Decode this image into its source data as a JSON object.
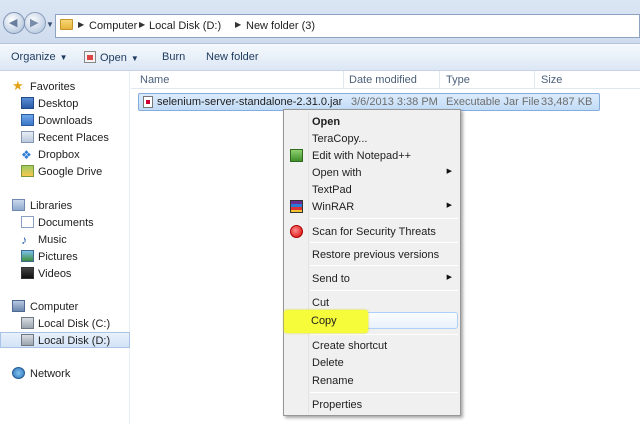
{
  "address": {
    "crumbs": [
      "Computer",
      "Local Disk (D:)",
      "New folder (3)"
    ]
  },
  "toolbar": {
    "organize": "Organize",
    "open": "Open",
    "burn": "Burn",
    "new_folder": "New folder"
  },
  "nav": {
    "favorites": "Favorites",
    "desktop": "Desktop",
    "downloads": "Downloads",
    "recent_places": "Recent Places",
    "dropbox": "Dropbox",
    "google_drive": "Google Drive",
    "libraries": "Libraries",
    "documents": "Documents",
    "music": "Music",
    "pictures": "Pictures",
    "videos": "Videos",
    "computer": "Computer",
    "disk_c": "Local Disk (C:)",
    "disk_d": "Local Disk (D:)",
    "network": "Network"
  },
  "columns": {
    "name": "Name",
    "date_modified": "Date modified",
    "type": "Type",
    "size": "Size"
  },
  "file": {
    "name": "selenium-server-standalone-2.31.0.jar",
    "date": "3/6/2013 3:38 PM",
    "type": "Executable Jar File",
    "size": "33,487 KB"
  },
  "context_menu": {
    "open": "Open",
    "teracopy": "TeraCopy...",
    "edit_npp": "Edit with Notepad++",
    "open_with": "Open with",
    "textpad": "TextPad",
    "winrar": "WinRAR",
    "scan": "Scan for Security Threats",
    "restore": "Restore previous versions",
    "send_to": "Send to",
    "cut": "Cut",
    "copy": "Copy",
    "create_shortcut": "Create shortcut",
    "delete": "Delete",
    "rename": "Rename",
    "properties": "Properties"
  },
  "colors": {
    "highlight": "#f6fb3a",
    "selection": "#c2dcf7"
  }
}
